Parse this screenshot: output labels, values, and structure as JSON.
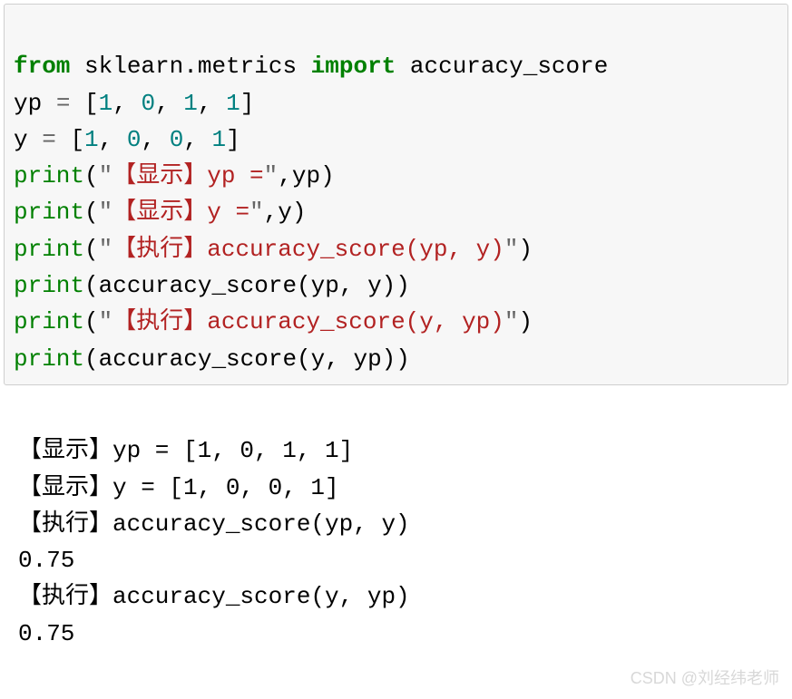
{
  "code": {
    "l1_from": "from",
    "l1_mod": " sklearn.metrics ",
    "l1_import": "import",
    "l1_name": " accuracy_score",
    "l2_lhs": "yp ",
    "l2_eq": "=",
    "l2_sp": " ",
    "l2_lb": "[",
    "l2_n1": "1",
    "l2_c1": ", ",
    "l2_n2": "0",
    "l2_c2": ", ",
    "l2_n3": "1",
    "l2_c3": ", ",
    "l2_n4": "1",
    "l2_rb": "]",
    "l3_lhs": "y ",
    "l3_eq": "=",
    "l3_sp": " ",
    "l3_lb": "[",
    "l3_n1": "1",
    "l3_c1": ", ",
    "l3_n2": "0",
    "l3_c2": ", ",
    "l3_n3": "0",
    "l3_c3": ", ",
    "l3_n4": "1",
    "l3_rb": "]",
    "l4_fn": "print",
    "l4_od": "(",
    "l4_q1": "\"",
    "l4_str": "【显示】yp =",
    "l4_q2": "\"",
    "l4_ca": ",yp)",
    "l5_fn": "print",
    "l5_od": "(",
    "l5_q1": "\"",
    "l5_str": "【显示】y =",
    "l5_q2": "\"",
    "l5_ca": ",y)",
    "l6_fn": "print",
    "l6_od": "(",
    "l6_q1": "\"",
    "l6_str": "【执行】accuracy_score(yp, y)",
    "l6_q2": "\"",
    "l6_cd": ")",
    "l7_fn": "print",
    "l7_od": "(accuracy_score(yp, y))",
    "l8_fn": "print",
    "l8_od": "(",
    "l8_q1": "\"",
    "l8_str": "【执行】accuracy_score(y, yp)",
    "l8_q2": "\"",
    "l8_cd": ")",
    "l9_fn": "print",
    "l9_od": "(accuracy_score(y, yp))"
  },
  "output": {
    "l1": "【显示】yp = [1, 0, 1, 1]",
    "l2": "【显示】y = [1, 0, 0, 1]",
    "l3": "【执行】accuracy_score(yp, y)",
    "l4": "0.75",
    "l5": "【执行】accuracy_score(y, yp)",
    "l6": "0.75"
  },
  "watermark": "CSDN @刘经纬老师"
}
